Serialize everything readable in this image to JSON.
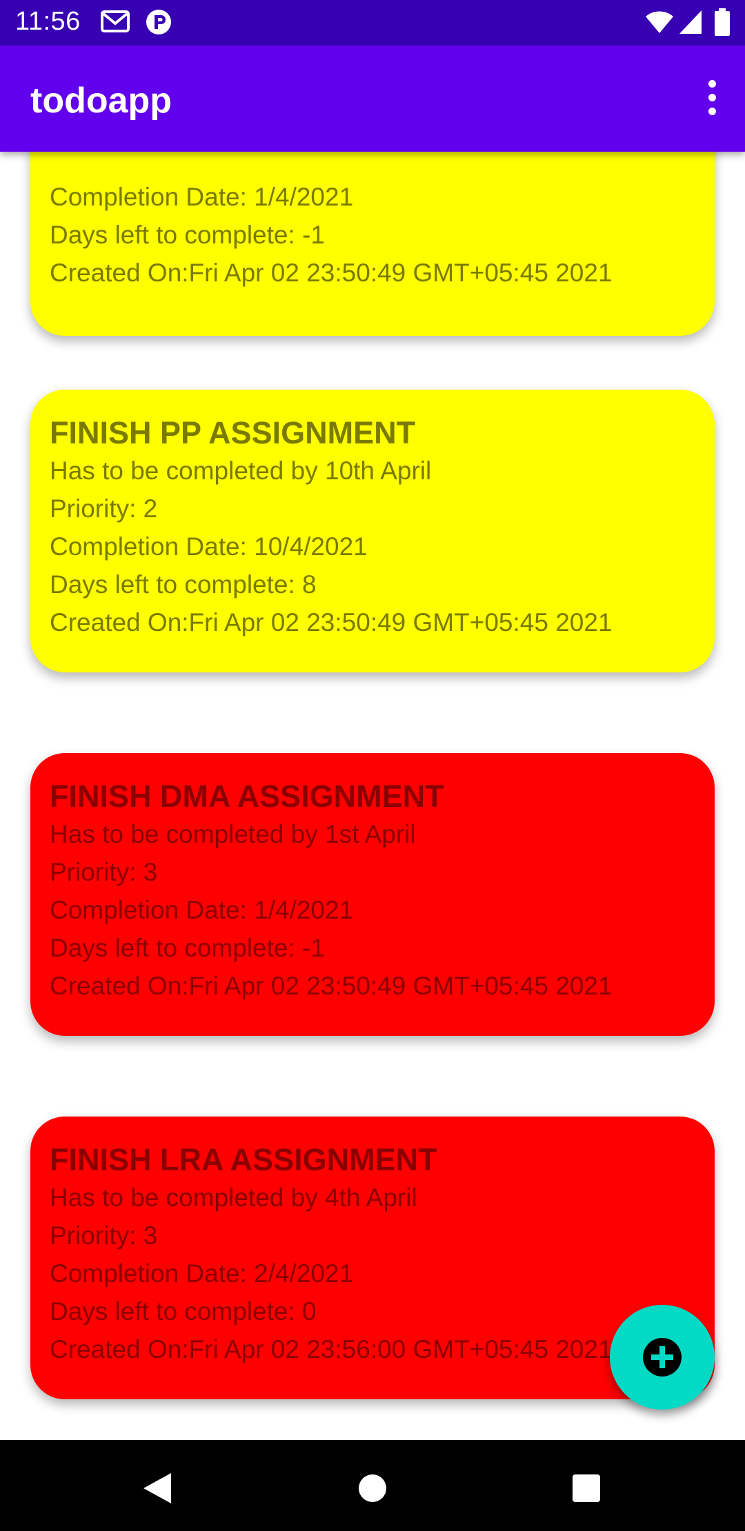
{
  "status_bar": {
    "time": "11:56",
    "icons": [
      "gmail-icon",
      "notification-app-icon",
      "wifi-icon",
      "signal-icon",
      "battery-icon"
    ]
  },
  "app_bar": {
    "title": "todoapp",
    "overflow_icon": "more-vert-icon"
  },
  "colors": {
    "status_bar": "#3700b3",
    "app_bar": "#6200ee",
    "card_low_priority": "#ffff00",
    "card_high_priority": "#ff0000",
    "fab": "#03dac5"
  },
  "todos": [
    {
      "lines": [
        "Completion Date: 1/4/2021",
        "Days left to complete: -1",
        "Created On:Fri Apr 02 23:50:49 GMT+05:45 2021"
      ],
      "color": "yellow",
      "partial": true
    },
    {
      "title": "FINISH PP ASSIGNMENT",
      "description": "Has to be completed by 10th April",
      "priority": "Priority: 2",
      "completion_date": "Completion Date: 10/4/2021",
      "days_left": "Days left to complete: 8",
      "created_on": "Created On:Fri Apr 02 23:50:49 GMT+05:45 2021",
      "color": "yellow"
    },
    {
      "title": "FINISH DMA ASSIGNMENT",
      "description": "Has to be completed by 1st April",
      "priority": "Priority: 3",
      "completion_date": "Completion Date: 1/4/2021",
      "days_left": "Days left to complete: -1",
      "created_on": "Created On:Fri Apr 02 23:50:49 GMT+05:45 2021",
      "color": "red"
    },
    {
      "title": "FINISH LRA ASSIGNMENT",
      "description": "Has to be completed by 4th April",
      "priority": "Priority: 3",
      "completion_date": "Completion Date: 2/4/2021",
      "days_left": "Days left to complete: 0",
      "created_on": "Created On:Fri Apr 02 23:56:00 GMT+05:45 2021",
      "color": "red"
    }
  ],
  "fab": {
    "icon": "add-circle-icon"
  },
  "nav_bar": {
    "buttons": [
      "back-icon",
      "home-icon",
      "recents-icon"
    ]
  }
}
